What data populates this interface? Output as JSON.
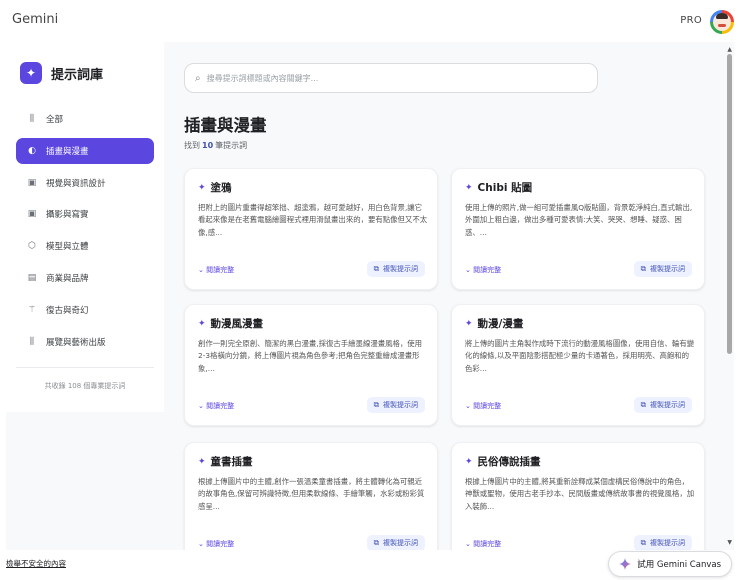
{
  "topbar": {
    "brand": "Gemini",
    "plan": "PRO"
  },
  "sidebar": {
    "title": "提示詞庫",
    "items": [
      {
        "label": "全部",
        "icon": "library-icon",
        "glyph": "⫼",
        "active": false
      },
      {
        "label": "插畫與漫畫",
        "icon": "palette-icon",
        "glyph": "◐",
        "active": true
      },
      {
        "label": "視覺與資訊設計",
        "icon": "image-icon",
        "glyph": "▣",
        "active": false
      },
      {
        "label": "攝影與寫實",
        "icon": "photo-icon",
        "glyph": "▣",
        "active": false
      },
      {
        "label": "模型與立體",
        "icon": "cube-icon",
        "glyph": "⬡",
        "active": false
      },
      {
        "label": "商業與品牌",
        "icon": "store-icon",
        "glyph": "▤",
        "active": false
      },
      {
        "label": "復古與奇幻",
        "icon": "magic-wand-icon",
        "glyph": "⚚",
        "active": false
      },
      {
        "label": "展覽與藝術出版",
        "icon": "book-icon",
        "glyph": "⫼",
        "active": false
      }
    ],
    "footer": "共收錄 108 個專業提示詞"
  },
  "main": {
    "search_placeholder": "搜尋提示詞標題或內容關鍵字...",
    "heading": "插畫與漫畫",
    "count_prefix": "找到",
    "count": "10",
    "count_suffix": "筆提示詞",
    "cards": [
      {
        "title": "塗鴉",
        "desc": "把附上的圖片重畫得超笨拙、超塗鴉，越可愛越好，用白色背景,讓它看起來像是在老舊電腦繪圖程式裡用滑鼠畫出來的，要有點像但又不太像,感...",
        "expand": "閱讀完整",
        "copy": "複製提示詞"
      },
      {
        "title": "Chibi 貼圖",
        "desc": "使用上傳的照片,做一組可愛插畫風Q版貼圖，背景乾淨純白,直式輸出,外圍加上粗白邊，做出多種可愛表情:大笑、哭哭、想睡、疑惑、困惑、...",
        "expand": "閱讀完整",
        "copy": "複製提示詞"
      },
      {
        "title": "動漫風漫畫",
        "desc": "創作一則完全原創、簡潔的黑白漫畫,採復古手繪墨線漫畫風格，使用2-3格橫向分鏡，將上傳圖片視為角色參考;把角色完整重繪成漫畫形象,...",
        "expand": "閱讀完整",
        "copy": "複製提示詞"
      },
      {
        "title": "動漫/漫畫",
        "desc": "將上傳的圖片主角製作成時下流行的動漫風格圖像，使用自信、輪有變化的線條,以及平面陰影搭配極少量的卡通著色，採用明亮、高飽和的色彩...",
        "expand": "閱讀完整",
        "copy": "複製提示詞"
      },
      {
        "title": "童書插畫",
        "desc": "根據上傳圖片中的主體,創作一張溫柔童書插畫，將主體轉化為可親近的故事角色,保留可辨識特徵,但用柔軟線條、手繪筆觸，水彩或粉彩質感呈...",
        "expand": "閱讀完整",
        "copy": "複製提示詞"
      },
      {
        "title": "民俗傳說插畫",
        "desc": "根據上傳圖片中的主體,將其重新詮釋成某個虛構民俗傳說中的角色，神獸或聖物，使用古老手抄本、民間版畫或傳統故事書的視覺風格，加入裝飾...",
        "expand": "閱讀完整",
        "copy": "複製提示詞"
      }
    ]
  },
  "footer": {
    "unsafe_link": "檢舉不安全的內容",
    "canvas_button": "試用 Gemini Canvas"
  },
  "colors": {
    "accent": "#5b47e0",
    "link": "#3f51b5"
  }
}
